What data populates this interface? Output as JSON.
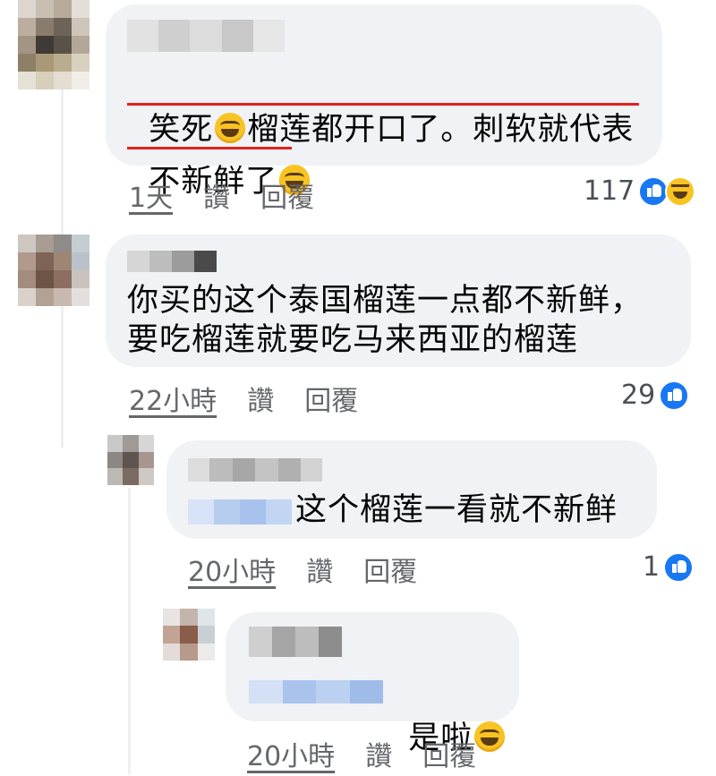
{
  "comments": [
    {
      "text_line1_a": "笑死",
      "text_line1_b": "榴莲都开口了。刺软就代表",
      "text_line2": "不新鲜了",
      "emoji": "grinning-squinting-face-icon",
      "time": "1天",
      "like_label": "讚",
      "reply_label": "回覆",
      "reaction_count": "117",
      "reactions": [
        "like-icon",
        "haha-icon"
      ]
    },
    {
      "text_line1": "你买的这个泰国榴莲一点都不新鲜，",
      "text_line2": "要吃榴莲就要吃马来西亚的榴莲",
      "time": "22小時",
      "like_label": "讚",
      "reply_label": "回覆",
      "reaction_count": "29",
      "reactions": [
        "like-icon"
      ]
    },
    {
      "text": "这个榴莲一看就不新鲜",
      "time": "20小時",
      "like_label": "讚",
      "reply_label": "回覆",
      "reaction_count": "1",
      "reactions": [
        "like-icon"
      ]
    },
    {
      "text": "是啦",
      "emoji": "face-with-tears-of-joy-icon",
      "time": "20小時",
      "like_label": "讚",
      "reply_label": "回覆"
    }
  ],
  "colors": {
    "bubble": "#f0f2f5",
    "underline": "#e4201f",
    "like": "#1877f2",
    "meta_text": "#65676b"
  }
}
